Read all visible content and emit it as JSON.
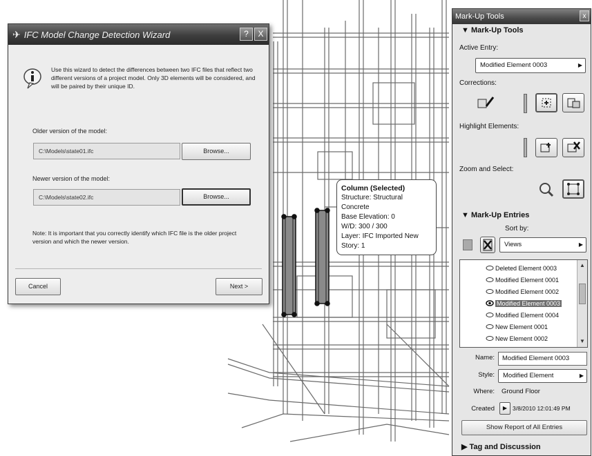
{
  "wizard": {
    "title": "IFC Model Change Detection Wizard",
    "help_label": "?",
    "close_label": "X",
    "intro": "Use this wizard to detect the differences between two IFC files that reflect two different versions of a project model. Only 3D elements will be considered, and will be paired by their unique ID.",
    "older_label": "Older version of the model:",
    "older_path": "C:\\Models\\state01.ifc",
    "newer_label": "Newer version of the model:",
    "newer_path": "C:\\Models\\state02.ifc",
    "browse_label": "Browse...",
    "note": "Note: It is important that you correctly identify which IFC file is the older project version and which the newer version.",
    "cancel_label": "Cancel",
    "next_label": "Next >"
  },
  "tooltip": {
    "title": "Column (Selected)",
    "structure": "Structure: Structural Concrete",
    "base_elevation": "Base Elevation: 0",
    "wd": "W/D: 300 / 300",
    "layer": "Layer: IFC Imported New",
    "story": "Story: 1"
  },
  "palette": {
    "window_title": "Mark-Up Tools",
    "close_label": "x",
    "section_tools": "Mark-Up Tools",
    "active_entry_label": "Active Entry:",
    "active_entry_value": "Modified Element 0003",
    "corrections_label": "Corrections:",
    "highlight_label": "Highlight Elements:",
    "zoom_label": "Zoom and Select:",
    "section_entries": "Mark-Up Entries",
    "sort_label": "Sort by:",
    "sort_value": "Views",
    "entries": [
      {
        "label": "Deleted Element 0003"
      },
      {
        "label": "Modified Element 0001"
      },
      {
        "label": "Modified Element 0002"
      },
      {
        "label": "Modified Element 0003"
      },
      {
        "label": "Modified Element 0004"
      },
      {
        "label": "New Element 0001"
      },
      {
        "label": "New Element 0002"
      }
    ],
    "name_label": "Name:",
    "name_value": "Modified Element 0003",
    "style_label": "Style:",
    "style_value": "Modified Element",
    "where_label": "Where:",
    "where_value": "Ground Floor",
    "created_label": "Created",
    "created_value": "3/8/2010 12:01:49 PM",
    "report_label": "Show Report of All Entries",
    "section_tag": "Tag and Discussion"
  },
  "colors": {
    "title_bar": "#3e3e3e",
    "selection": "#6e6e6e",
    "dialog_bg": "#ededed",
    "palette_bg": "#e6e6e6"
  }
}
